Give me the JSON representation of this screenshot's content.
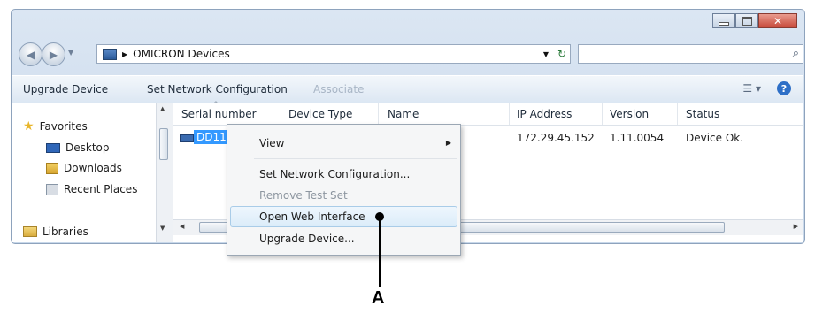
{
  "address": {
    "path": "OMICRON Devices"
  },
  "toolbar": {
    "upgrade": "Upgrade Device",
    "set_network": "Set Network Configuration",
    "associate": "Associate"
  },
  "nav": {
    "favorites": "Favorites",
    "desktop": "Desktop",
    "downloads": "Downloads",
    "recent": "Recent Places",
    "libraries": "Libraries"
  },
  "columns": [
    "Serial number",
    "Device Type",
    "Name",
    "IP Address",
    "Version",
    "Status"
  ],
  "row": {
    "serial": "DD11",
    "ip": "172.29.45.152",
    "version": "1.11.0054",
    "status": "Device Ok."
  },
  "menu": {
    "view": "View",
    "set_network": "Set Network Configuration...",
    "remove": "Remove Test Set",
    "open_web": "Open Web Interface",
    "upgrade": "Upgrade Device..."
  },
  "callout": "A",
  "colors": {
    "selection": "#3399ff",
    "window_frame": "#c8d8ea"
  }
}
